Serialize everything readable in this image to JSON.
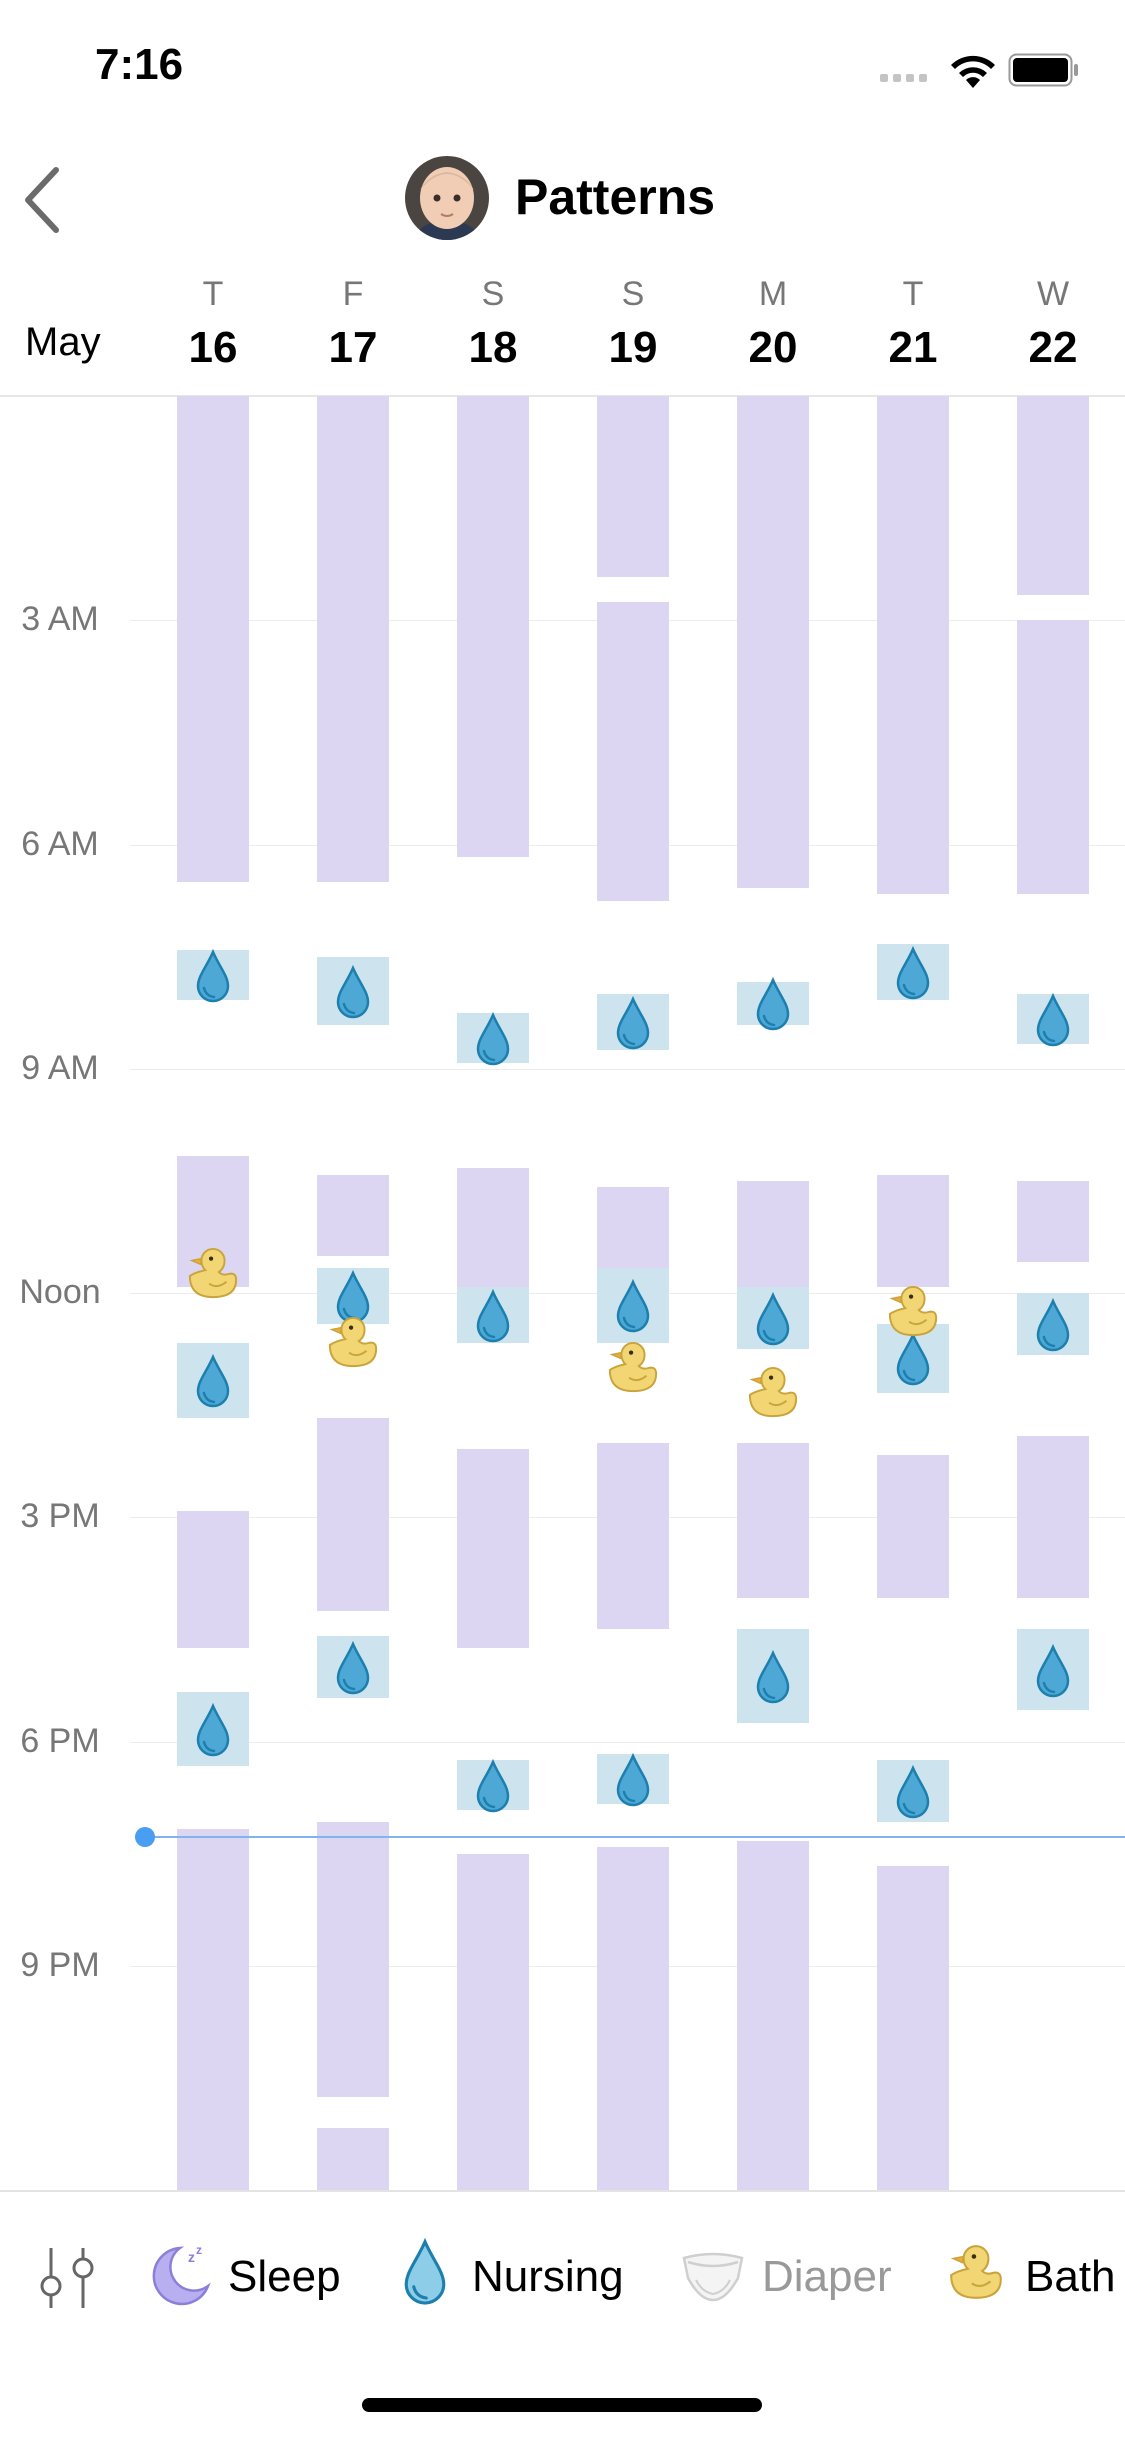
{
  "status_bar": {
    "time": "7:16"
  },
  "nav": {
    "title": "Patterns"
  },
  "header": {
    "month": "May",
    "days": [
      {
        "dow": "T",
        "date": "16"
      },
      {
        "dow": "F",
        "date": "17"
      },
      {
        "dow": "S",
        "date": "18"
      },
      {
        "dow": "S",
        "date": "19"
      },
      {
        "dow": "M",
        "date": "20"
      },
      {
        "dow": "T",
        "date": "21"
      },
      {
        "dow": "W",
        "date": "22"
      }
    ]
  },
  "grid": {
    "hour_labels": [
      "3 AM",
      "6 AM",
      "9 AM",
      "Noon",
      "3 PM",
      "6 PM",
      "9 PM"
    ],
    "now_time": "19:16",
    "days": [
      {
        "sleep": [
          [
            "00:00",
            "06:30"
          ],
          [
            "10:10",
            "11:55"
          ],
          [
            "14:55",
            "16:45"
          ],
          [
            "19:10",
            "24:00"
          ]
        ],
        "nursing": [
          [
            "07:25",
            "08:05"
          ],
          [
            "12:40",
            "13:40"
          ],
          [
            "17:20",
            "18:20"
          ]
        ],
        "bath": [
          "11:45"
        ]
      },
      {
        "sleep": [
          [
            "00:00",
            "06:30"
          ],
          [
            "10:25",
            "11:30"
          ],
          [
            "13:40",
            "16:15"
          ],
          [
            "19:05",
            "22:45"
          ],
          [
            "23:10",
            "24:00"
          ]
        ],
        "nursing": [
          [
            "07:30",
            "08:25"
          ],
          [
            "11:40",
            "12:25"
          ],
          [
            "16:35",
            "17:25"
          ]
        ],
        "bath": [
          "12:40"
        ]
      },
      {
        "sleep": [
          [
            "00:00",
            "06:10"
          ],
          [
            "10:20",
            "11:55"
          ],
          [
            "14:05",
            "16:45"
          ],
          [
            "19:30",
            "24:00"
          ]
        ],
        "nursing": [
          [
            "08:15",
            "08:55"
          ],
          [
            "11:55",
            "12:40"
          ],
          [
            "18:15",
            "18:55"
          ]
        ],
        "bath": []
      },
      {
        "sleep": [
          [
            "00:00",
            "02:25"
          ],
          [
            "02:45",
            "06:45"
          ],
          [
            "10:35",
            "11:45"
          ],
          [
            "14:00",
            "16:30"
          ],
          [
            "19:25",
            "24:00"
          ]
        ],
        "nursing": [
          [
            "08:00",
            "08:45"
          ],
          [
            "11:40",
            "12:40"
          ],
          [
            "18:10",
            "18:50"
          ]
        ],
        "bath": [
          "13:00"
        ]
      },
      {
        "sleep": [
          [
            "00:00",
            "06:35"
          ],
          [
            "10:30",
            "12:10"
          ],
          [
            "14:00",
            "16:05"
          ],
          [
            "19:20",
            "24:00"
          ]
        ],
        "nursing": [
          [
            "07:50",
            "08:25"
          ],
          [
            "11:55",
            "12:45"
          ],
          [
            "16:30",
            "17:45"
          ]
        ],
        "bath": [
          "13:20"
        ]
      },
      {
        "sleep": [
          [
            "00:00",
            "06:40"
          ],
          [
            "10:25",
            "11:55"
          ],
          [
            "14:10",
            "16:05"
          ],
          [
            "19:40",
            "24:00"
          ]
        ],
        "nursing": [
          [
            "07:20",
            "08:05"
          ],
          [
            "12:25",
            "13:20"
          ],
          [
            "18:15",
            "19:05"
          ]
        ],
        "bath": [
          "12:15"
        ]
      },
      {
        "sleep": [
          [
            "00:00",
            "02:40"
          ],
          [
            "03:00",
            "06:40"
          ],
          [
            "10:30",
            "11:35"
          ],
          [
            "13:55",
            "16:05"
          ]
        ],
        "nursing": [
          [
            "08:00",
            "08:40"
          ],
          [
            "12:00",
            "12:50"
          ],
          [
            "16:30",
            "17:35"
          ]
        ],
        "bath": []
      }
    ]
  },
  "legend": {
    "items": [
      {
        "label": "Sleep",
        "color": "#8b7fd9",
        "icon": "moon-zz-icon",
        "active": true
      },
      {
        "label": "Nursing",
        "color": "#2a96c8",
        "icon": "droplet-icon",
        "active": true
      },
      {
        "label": "Diaper",
        "color": "#9a9a9a",
        "icon": "diaper-icon",
        "active": false
      },
      {
        "label": "Bath",
        "color": "#f2d674",
        "icon": "duck-icon",
        "active": true
      }
    ]
  },
  "colors": {
    "sleep_bar": "#dcd6f2",
    "nursing_box": "#cde4ee",
    "nursing_drop": "#4da8d6",
    "bath_duck": "#f2d674",
    "now_line": "#7fb5ec"
  }
}
